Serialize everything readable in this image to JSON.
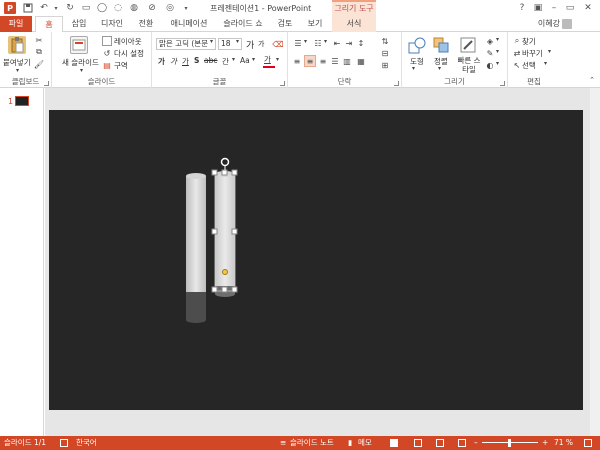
{
  "titlebar": {
    "doc_title": "프레젠테이션1 - PowerPoint",
    "context_header": "그리기 도구",
    "app_icon": "P",
    "help": "?",
    "minimize": "–",
    "restore": "▭",
    "close": "✕"
  },
  "tabs": [
    {
      "label": "파일"
    },
    {
      "label": "홈"
    },
    {
      "label": "삽입"
    },
    {
      "label": "디자인"
    },
    {
      "label": "전환"
    },
    {
      "label": "애니메이션"
    },
    {
      "label": "슬라이드 쇼"
    },
    {
      "label": "검토"
    },
    {
      "label": "보기"
    },
    {
      "label": "서식"
    }
  ],
  "user_name": "이혜강",
  "ribbon": {
    "clipboard": {
      "paste": "붙여넣기",
      "label": "클립보드"
    },
    "slides": {
      "new_slide": "새 슬라이드",
      "layout": "레이아웃",
      "reset": "다시 설정",
      "section": "구역",
      "label": "슬라이드"
    },
    "font": {
      "font_name": "맑은 고딕 (본문",
      "font_size": "18",
      "label": "글꼴",
      "grow": "가",
      "shrink": "가",
      "char_spacing": "간",
      "case": "Aa",
      "color": "가",
      "bold": "가",
      "italic": "가",
      "underline": "가",
      "shadow": "S",
      "strike": "abc"
    },
    "paragraph": {
      "label": "단락"
    },
    "drawing": {
      "shapes": "도형",
      "arrange": "정렬",
      "quick_styles": "빠른 스타일",
      "label": "그리기"
    },
    "editing": {
      "find": "찾기",
      "replace": "바꾸기",
      "select": "선택",
      "label": "편집"
    }
  },
  "slide_panel": {
    "number": "1"
  },
  "statusbar": {
    "slide_info": "슬라이드 1/1",
    "language": "한국어",
    "notes": "슬라이드 노트",
    "comments": "메모",
    "zoom": "71 %"
  },
  "colors": {
    "accent": "#d24726",
    "slide_bg": "#262626",
    "context_tab": "#fbe3d6"
  }
}
